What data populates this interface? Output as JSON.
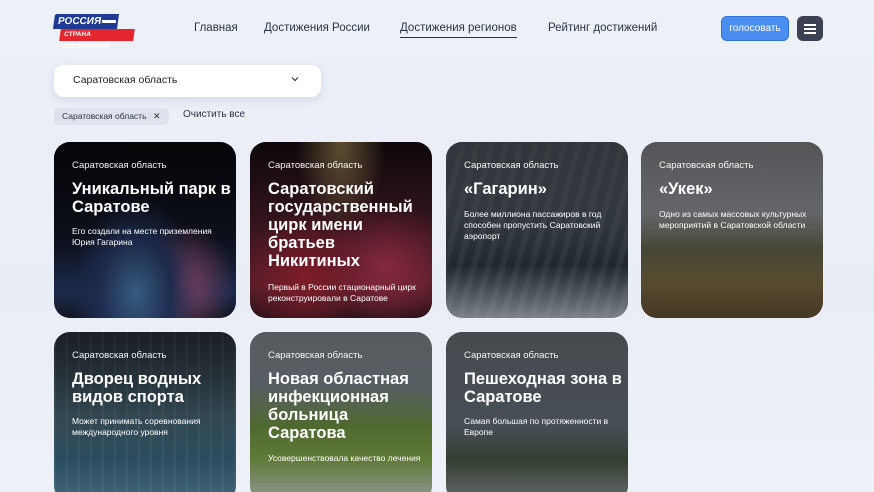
{
  "header": {
    "logo_top": "РОССИЯ",
    "logo_bottom": "СТРАНА ДОСТИЖЕНИЙ",
    "nav": [
      {
        "label": "Главная"
      },
      {
        "label": "Достижения России"
      },
      {
        "label": "Достижения регионов"
      },
      {
        "label": "Рейтинг достижений"
      }
    ],
    "vote_label": "голосовать",
    "menu_icon": "hamburger-icon"
  },
  "filter": {
    "select_value": "Саратовская область",
    "chip_label": "Саратовская область",
    "clear_label": "Очистить все"
  },
  "cards": [
    {
      "region": "Саратовская область",
      "title": "Уникальный парк в Саратове",
      "desc": "Его создали на месте приземления Юрия Гагарина"
    },
    {
      "region": "Саратовская область",
      "title": "Саратовский государственный цирк имени братьев Никитиных",
      "desc": "Первый в России стационарный цирк реконструировали в Саратове"
    },
    {
      "region": "Саратовская область",
      "title": "«Гагарин»",
      "desc": "Более миллиона пассажиров в год способен пропустить Саратовский аэропорт"
    },
    {
      "region": "Саратовская область",
      "title": "«Укек»",
      "desc": "Одно из самых массовых культурных мероприятий в Саратовской области"
    },
    {
      "region": "Саратовская область",
      "title": "Дворец водных видов спорта",
      "desc": "Может принимать соревнования международного уровня"
    },
    {
      "region": "Саратовская область",
      "title": "Новая областная инфекционная больница Саратова",
      "desc": "Усовершенствовала качество лечения"
    },
    {
      "region": "Саратовская область",
      "title": "Пешеходная зона в Саратове",
      "desc": "Самая большая по протяженности в Европе"
    }
  ]
}
